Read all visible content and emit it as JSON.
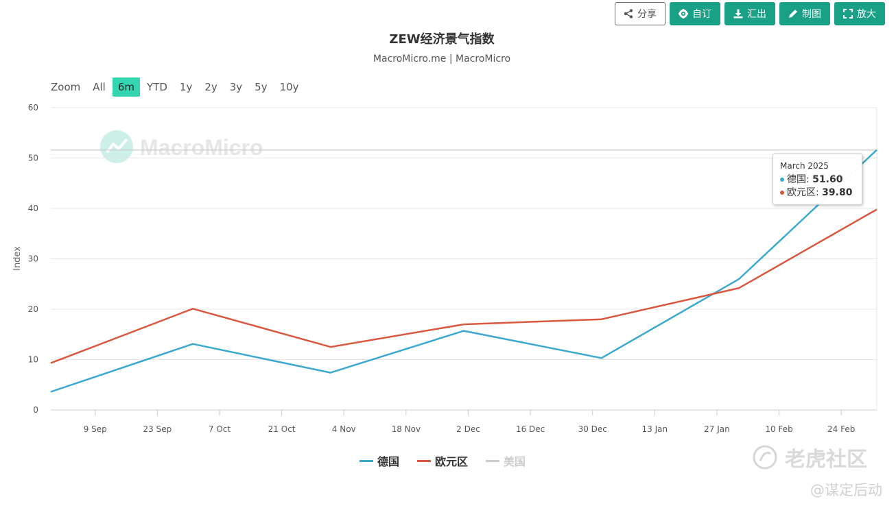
{
  "toolbar": {
    "share": "分享",
    "customize": "自订",
    "export": "汇出",
    "draw": "制图",
    "enlarge": "放大"
  },
  "colors": {
    "germany": "#3aa8cf",
    "eurozone": "#d9573f",
    "usa_hidden": "#cccccc",
    "accent": "#1aa086",
    "zoom_active": "#33d6b0"
  },
  "zoom": {
    "label": "Zoom",
    "options": [
      "All",
      "6m",
      "YTD",
      "1y",
      "2y",
      "3y",
      "5y",
      "10y"
    ],
    "active": "6m"
  },
  "tooltip": {
    "date": "March 2025",
    "rows": [
      {
        "name": "德国",
        "value": "51.60"
      },
      {
        "name": "欧元区",
        "value": "39.80"
      }
    ]
  },
  "watermark": {
    "brand": "MacroMicro",
    "logo_text": "老虎社区",
    "user": "@谋定后动"
  },
  "chart_data": {
    "type": "line",
    "title": "ZEW经济景气指数",
    "subtitle": "MacroMicro.me | MacroMicro",
    "ylabel": "Index",
    "ylim": [
      0,
      60
    ],
    "yticks": [
      0,
      10,
      20,
      30,
      40,
      50,
      60
    ],
    "xlim": [
      "2024-08-30",
      "2025-03-04"
    ],
    "xticks": [
      {
        "date": "2024-09-09",
        "label": "9 Sep"
      },
      {
        "date": "2024-09-23",
        "label": "23 Sep"
      },
      {
        "date": "2024-10-07",
        "label": "7 Oct"
      },
      {
        "date": "2024-10-21",
        "label": "21 Oct"
      },
      {
        "date": "2024-11-04",
        "label": "4 Nov"
      },
      {
        "date": "2024-11-18",
        "label": "18 Nov"
      },
      {
        "date": "2024-12-02",
        "label": "2 Dec"
      },
      {
        "date": "2024-12-16",
        "label": "16 Dec"
      },
      {
        "date": "2024-12-30",
        "label": "30 Dec"
      },
      {
        "date": "2025-01-13",
        "label": "13 Jan"
      },
      {
        "date": "2025-01-27",
        "label": "27 Jan"
      },
      {
        "date": "2025-02-10",
        "label": "10 Feb"
      },
      {
        "date": "2025-02-24",
        "label": "24 Feb"
      }
    ],
    "x": [
      "2024-08-30",
      "2024-10-01",
      "2024-11-01",
      "2024-12-01",
      "2025-01-01",
      "2025-02-01",
      "2025-03-04"
    ],
    "series": [
      {
        "name": "德国",
        "values": [
          3.6,
          13.1,
          7.4,
          15.7,
          10.3,
          26.0,
          51.6
        ],
        "visible": true
      },
      {
        "name": "欧元区",
        "values": [
          9.3,
          20.1,
          12.5,
          17.0,
          18.0,
          24.2,
          39.8
        ],
        "visible": true
      },
      {
        "name": "美国",
        "values": [],
        "visible": false
      }
    ],
    "crosshair_y": 51.6,
    "grid": true,
    "legend_position": "bottom"
  }
}
